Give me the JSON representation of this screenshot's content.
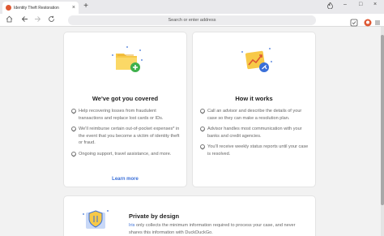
{
  "browser": {
    "tab_title": "Identity Theft Restoration",
    "tab_close": "×",
    "new_tab": "+",
    "address_placeholder": "Search or enter address",
    "window_controls": [
      "–",
      "□",
      "×"
    ]
  },
  "cards": {
    "left": {
      "title": "We've got you covered",
      "items": [
        "Help recovering losses from fraudulent transactions and replace lost cards or IDs.",
        "We'll reimburse certain out-of-pocket expenses* in the event that you become a victim of identity theft or fraud.",
        "Ongoing support, travel assistance, and more."
      ],
      "link": "Learn more"
    },
    "right": {
      "title": "How it works",
      "items": [
        "Call an advisor and describe the details of your case so they can make a resolution plan.",
        "Advisor handles most communication with your banks and credit agencies.",
        "You'll receive weekly status reports until your case is resolved."
      ]
    },
    "bottom": {
      "title": "Private by design",
      "iris": "Iris",
      "text_rest": " only collects the minimum information required to process your case, and never shares this information with DuckDuckGo."
    }
  },
  "colors": {
    "accent_blue": "#3a6fd8",
    "folder_yellow": "#f7c948",
    "plus_green": "#3fb04c",
    "duck_orange": "#de5833"
  }
}
